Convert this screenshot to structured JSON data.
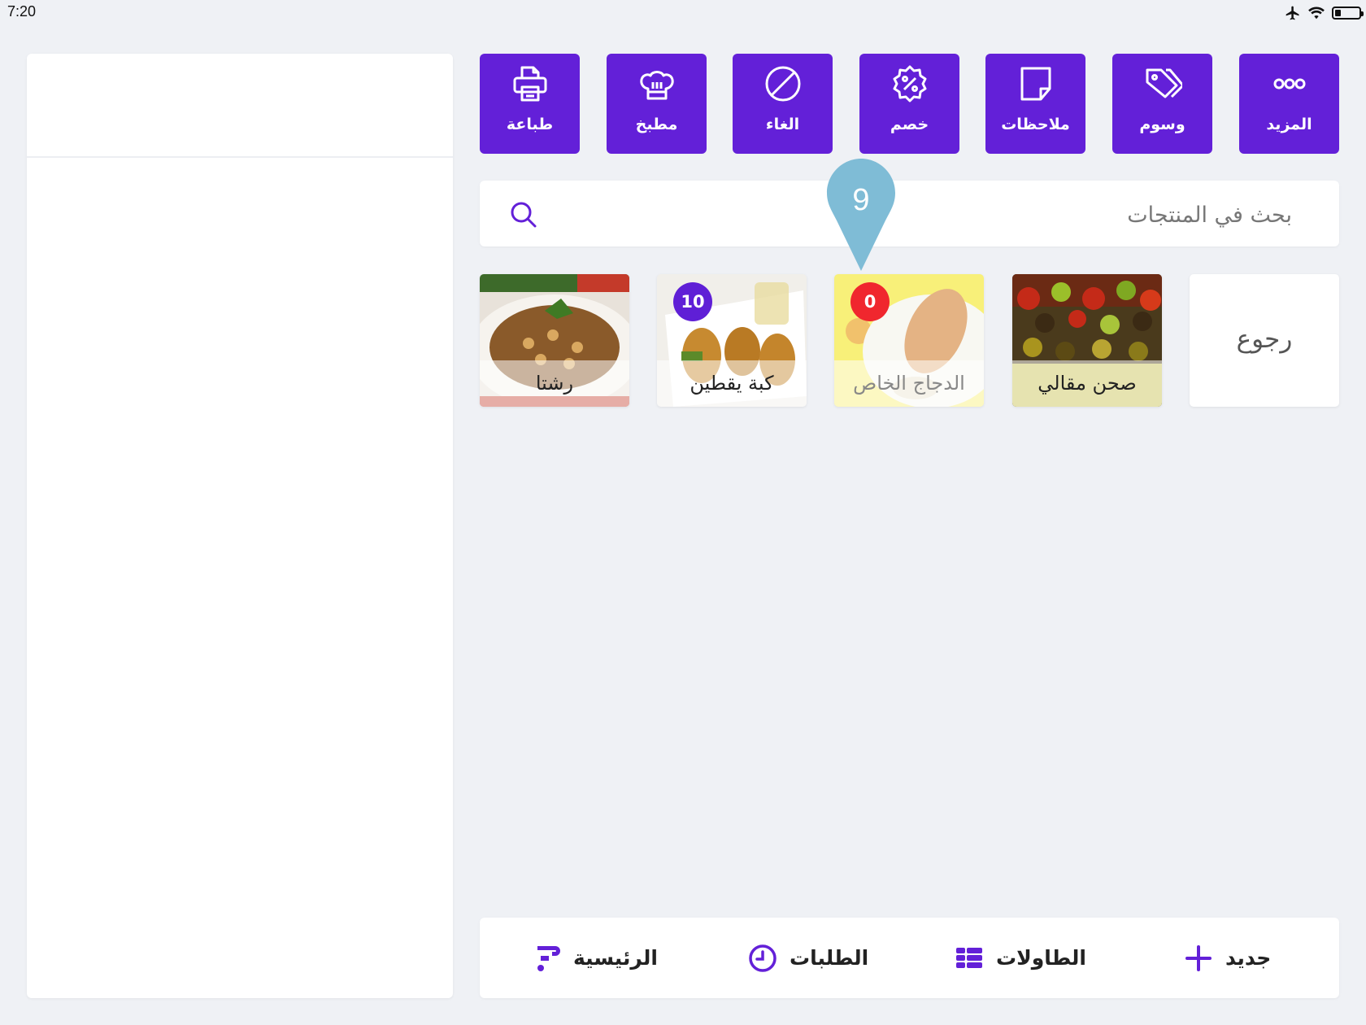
{
  "status_bar": {
    "time": "7:20",
    "battery_level": 0.25
  },
  "toolbar": {
    "buttons": [
      {
        "label": "المزيد",
        "icon": "more-icon"
      },
      {
        "label": "وسوم",
        "icon": "tags-icon"
      },
      {
        "label": "ملاحظات",
        "icon": "note-icon"
      },
      {
        "label": "خصم",
        "icon": "discount-icon"
      },
      {
        "label": "الغاء",
        "icon": "cancel-icon"
      },
      {
        "label": "مطبخ",
        "icon": "chef-hat-icon"
      },
      {
        "label": "طباعة",
        "icon": "printer-icon"
      }
    ]
  },
  "search": {
    "placeholder": "بحث في المنتجات",
    "value": ""
  },
  "products": {
    "back_label": "رجوع",
    "items": [
      {
        "name": "صحن مقالي",
        "badge": null
      },
      {
        "name": "الدجاج الخاص",
        "badge": "0",
        "badge_color": "#f0272e",
        "disabled": true
      },
      {
        "name": "كبة يقطين",
        "badge": "10",
        "badge_color": "#5f1fd6"
      },
      {
        "name": "رشتا",
        "badge": null
      }
    ]
  },
  "tutorial_marker": {
    "number": "9"
  },
  "bottom_nav": {
    "items": [
      {
        "label": "جديد",
        "icon": "plus-icon"
      },
      {
        "label": "الطاولات",
        "icon": "tables-icon"
      },
      {
        "label": "الطلبات",
        "icon": "clock-icon"
      },
      {
        "label": "الرئيسية",
        "icon": "brand-logo-icon"
      }
    ]
  },
  "colors": {
    "accent": "#6320d8",
    "background": "#eff1f5",
    "marker": "#7fbcd6",
    "alert": "#f0272e"
  }
}
